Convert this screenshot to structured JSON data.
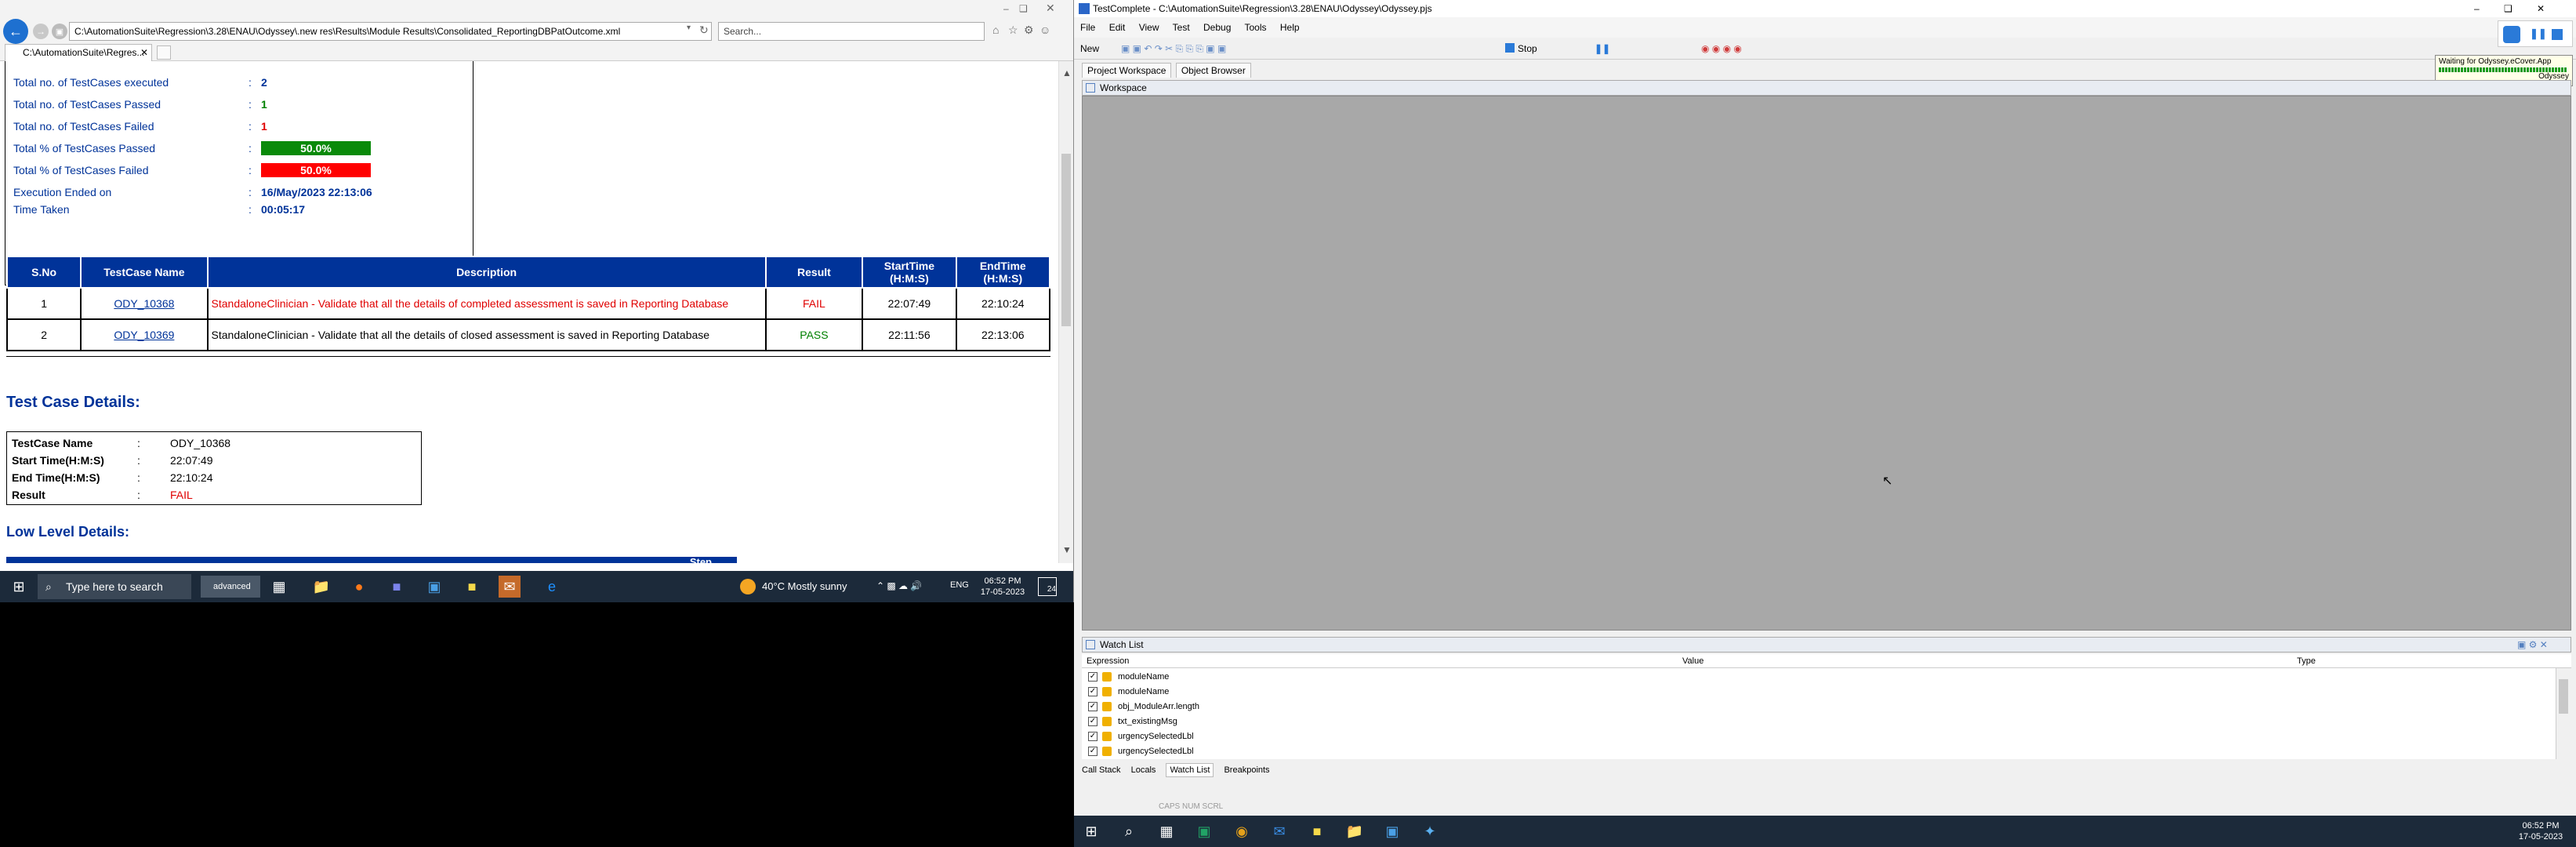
{
  "browser": {
    "address": "C:\\AutomationSuite\\Regression\\3.28\\ENAU\\Odyssey\\.new res\\Results\\Module Results\\Consolidated_ReportingDBPatOutcome.xml",
    "search_placeholder": "Search...",
    "tab_title": "C:\\AutomationSuite\\Regres..."
  },
  "summary": {
    "rows": [
      {
        "label": "Total no. of TestCases executed",
        "value": "2"
      },
      {
        "label": "Total no. of TestCases Passed",
        "value": "1"
      },
      {
        "label": "Total no. of TestCases Failed",
        "value": "1"
      },
      {
        "label": "Total % of TestCases Passed",
        "value": "50.0%"
      },
      {
        "label": "Total % of TestCases Failed",
        "value": "50.0%"
      },
      {
        "label": "Execution Ended on",
        "value": "16/May/2023 22:13:06"
      },
      {
        "label": "Time Taken",
        "value": "00:05:17"
      }
    ],
    "colon": ":",
    "pass_pct": 0.5,
    "fail_pct": 0.5
  },
  "results": {
    "headers": [
      "S.No",
      "TestCase Name",
      "Description",
      "Result",
      "StartTime\n(H:M:S)",
      "EndTime\n(H:M:S)"
    ],
    "rows": [
      {
        "sno": "1",
        "name": "ODY_10368",
        "desc": "StandaloneClinician - Validate that all the details of completed assessment is saved in Reporting Database",
        "result": "FAIL",
        "start": "22:07:49",
        "end": "22:10:24"
      },
      {
        "sno": "2",
        "name": "ODY_10369",
        "desc": "StandaloneClinician - Validate that all the details of closed assessment is saved in Reporting Database",
        "result": "PASS",
        "start": "22:11:56",
        "end": "22:13:06"
      }
    ]
  },
  "details": {
    "heading": "Test Case Details:",
    "rows": [
      {
        "label": "TestCase Name",
        "value": "ODY_10368"
      },
      {
        "label": "Start Time(H:M:S)",
        "value": "22:07:49"
      },
      {
        "label": "End Time(H:M:S)",
        "value": "22:10:24"
      },
      {
        "label": "Result",
        "value": "FAIL"
      }
    ],
    "colon": ":"
  },
  "low": {
    "heading": "Low Level Details:",
    "bar_label": "Step"
  },
  "taskbar_left": {
    "search": "Type here to search",
    "weather": "40°C  Mostly sunny",
    "lang": "ENG",
    "time": "06:52 PM",
    "date": "17-05-2023",
    "notif": "24",
    "advanced": "advanced"
  },
  "tc": {
    "title": "TestComplete - C:\\AutomationSuite\\Regression\\3.28\\ENAU\\Odyssey\\Odyssey.pjs",
    "menu": [
      "File",
      "Edit",
      "View",
      "Test",
      "Debug",
      "Tools",
      "Help"
    ],
    "toolbar_new": "New",
    "toolbar_stop": "Stop",
    "tabs": [
      "Project Workspace",
      "Object Browser"
    ],
    "workspace": "Workspace",
    "watch_title": "Watch List",
    "cols": [
      "Expression",
      "Value",
      "Type"
    ],
    "watch": [
      "moduleName",
      "moduleName",
      "obj_ModuleArr.length",
      "txt_existingMsg",
      "urgencySelectedLbl",
      "urgencySelectedLbl"
    ],
    "bottom_tabs": [
      "Call Stack",
      "Locals",
      "Watch List",
      "Breakpoints"
    ],
    "status": "CAPS  NUM  SCRL",
    "tooltip": "Waiting for Odyssey.eCover.App",
    "tooltip_sub": "Odyssey",
    "time": "06:52 PM",
    "date": "17-05-2023"
  },
  "colors": {
    "navy": "#003399",
    "pass": "#008000",
    "fail": "#e00000"
  }
}
